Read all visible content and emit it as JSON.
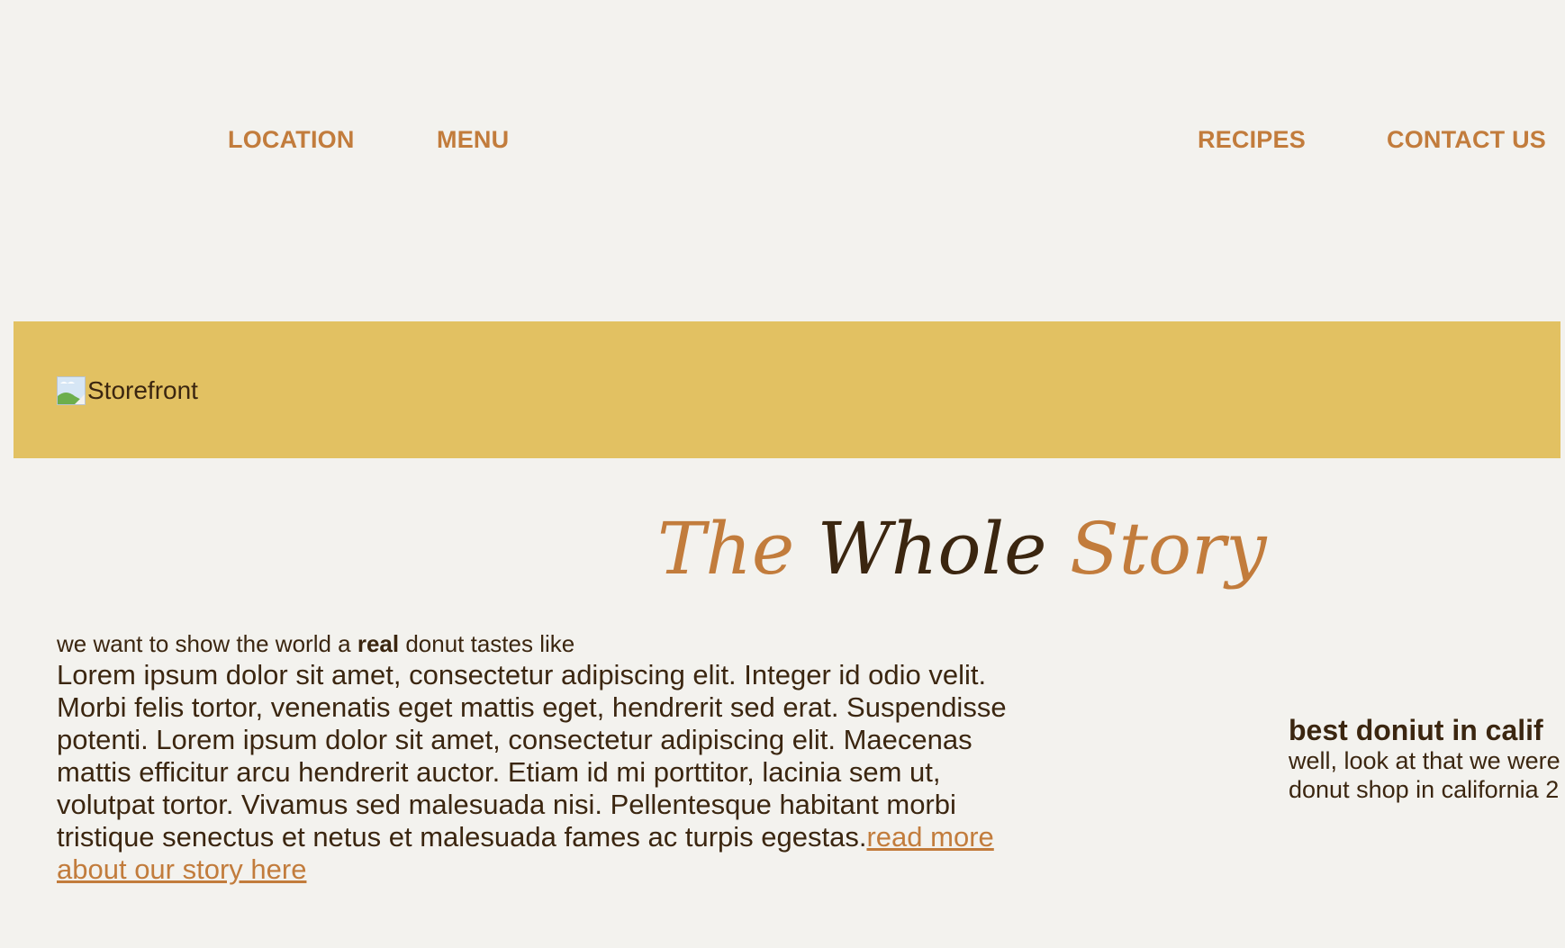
{
  "nav": {
    "left": [
      {
        "label": "LOCATION"
      },
      {
        "label": "MENU"
      }
    ],
    "right": [
      {
        "label": "RECIPES"
      },
      {
        "label": "CONTACT US"
      }
    ]
  },
  "hero": {
    "image_alt": "Storefront",
    "background_color": "#e2c162"
  },
  "story": {
    "title_word_1": "The",
    "title_word_2": "Whole",
    "title_word_3": "Story",
    "tagline_before": "we want to show the world a ",
    "tagline_bold": "real",
    "tagline_after": " donut tastes like",
    "body": "Lorem ipsum dolor sit amet, consectetur adipiscing elit. Integer id odio velit. Morbi felis tortor, venenatis eget mattis eget, hendrerit sed erat. Suspendisse potenti. Lorem ipsum dolor sit amet, consectetur adipiscing elit. Maecenas mattis efficitur arcu hendrerit auctor. Etiam id mi porttitor, lacinia sem ut, volutpat tortor. Vivamus sed malesuada nisi. Pellentesque habitant morbi tristique senectus et netus et malesuada fames ac turpis egestas.",
    "read_more_link": "read more about our story here"
  },
  "award": {
    "heading": "best doniut in calif",
    "line_1": "well, look at that we were",
    "line_2": "donut shop in california 2"
  },
  "colors": {
    "accent": "#c27c3c",
    "text": "#3b2610",
    "background": "#f3f2ee",
    "banner": "#e2c162"
  }
}
